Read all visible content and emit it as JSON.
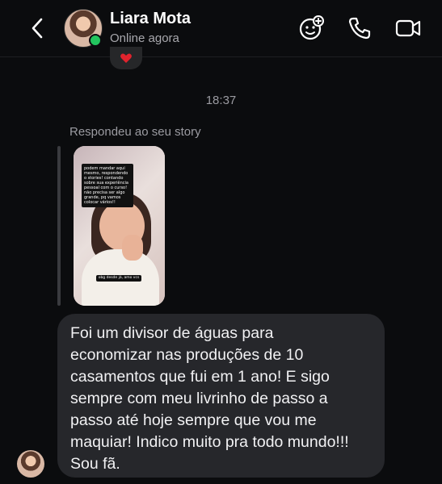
{
  "header": {
    "name": "Liara Mota",
    "status": "Online agora",
    "icons": {
      "back": "chevron-left-icon",
      "sticker": "add-sticker-icon",
      "call": "phone-icon",
      "video": "video-camera-icon"
    },
    "online_color": "#22c55e"
  },
  "reaction": {
    "icon": "heart-icon",
    "color": "#e0232d"
  },
  "conversation": {
    "timestamp": "18:37",
    "reply_label": "Respondeu ao seu story",
    "story": {
      "caption_top": "podem mandar aqui mesmo, respondendo o stories! contando sobre sua experiência pessoal com o curso! não precisa ser algo grande, pq vamos colocar vários!!",
      "caption_bottom": "obg desde já, amo vcs"
    },
    "message_lines": [
      "Foi um divisor de águas para",
      "economizar nas produções de 10",
      "casamentos que fui em 1 ano! E sigo",
      "sempre com meu livrinho de passo a",
      "passo até hoje sempre que vou me",
      "maquiar! Indico muito pra todo mundo!!!",
      "Sou fã."
    ]
  }
}
